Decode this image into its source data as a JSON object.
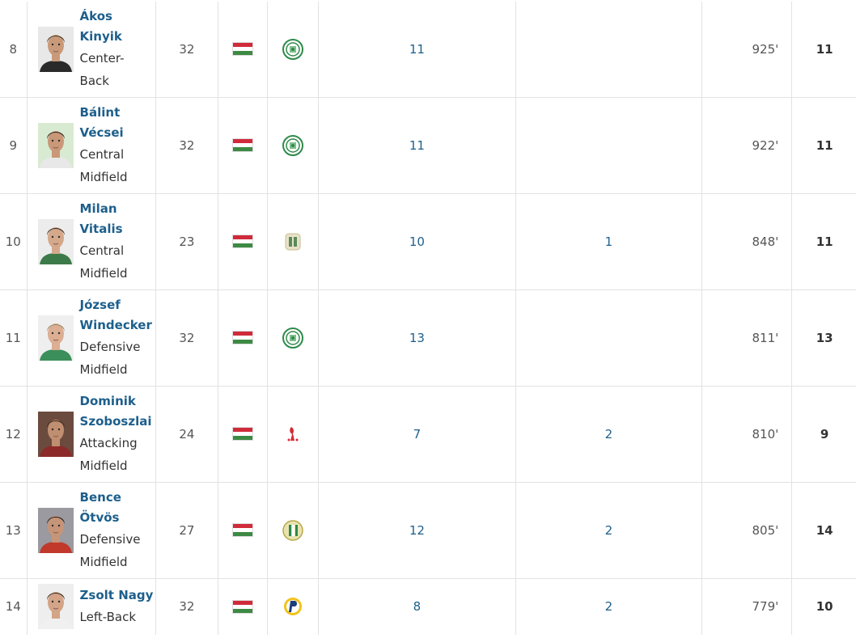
{
  "colors": {
    "link": "#1d5f8c",
    "border": "#e2e2e2",
    "flag_red": "#d02b3b",
    "flag_white": "#ffffff",
    "flag_green": "#3d8a44"
  },
  "rows": [
    {
      "rank": "8",
      "name_line1": "Ákos",
      "name_line2": "Kinyik",
      "position_line1": "Center-",
      "position_line2": "Back",
      "age": "32",
      "nationality": "Hungary",
      "club_icon": "ferencvaros-crest-icon",
      "apps": "11",
      "goals": "",
      "minutes": "925'",
      "total": "11",
      "skin": "#c99a7a",
      "hair": "#4a3a2c",
      "bg": "#e8e8e8",
      "shirt": "#2a2a2a"
    },
    {
      "rank": "9",
      "name_line1": "Bálint",
      "name_line2": "Vécsei",
      "position_line1": "Central",
      "position_line2": "Midfield",
      "age": "32",
      "nationality": "Hungary",
      "club_icon": "ferencvaros-crest-icon",
      "apps": "11",
      "goals": "",
      "minutes": "922'",
      "total": "11",
      "skin": "#c99878",
      "hair": "#2e2620",
      "bg": "#d9ead3",
      "shirt": "#e8e8e8"
    },
    {
      "rank": "10",
      "name_line1": "Milan",
      "name_line2": "Vitalis",
      "position_line1": "Central",
      "position_line2": "Midfield",
      "age": "23",
      "nationality": "Hungary",
      "club_icon": "paksi-crest-icon",
      "apps": "10",
      "goals": "1",
      "minutes": "848'",
      "total": "11",
      "skin": "#d4a88a",
      "hair": "#3a2d25",
      "bg": "#ececec",
      "shirt": "#3d7a4a"
    },
    {
      "rank": "11",
      "name_line1": "József",
      "name_line2": "Windecker",
      "position_line1": "Defensive",
      "position_line2": "Midfield",
      "age": "32",
      "nationality": "Hungary",
      "club_icon": "ferencvaros-crest-icon",
      "apps": "13",
      "goals": "",
      "minutes": "811'",
      "total": "13",
      "skin": "#dcae92",
      "hair": "#9a8a70",
      "bg": "#efefef",
      "shirt": "#3b8f5a"
    },
    {
      "rank": "12",
      "name_line1": "Dominik",
      "name_line2": "Szoboszlai",
      "position_line1": "Attacking",
      "position_line2": "Midfield",
      "age": "24",
      "nationality": "Hungary",
      "club_icon": "liverpool-crest-icon",
      "apps": "7",
      "goals": "2",
      "minutes": "810'",
      "total": "9",
      "skin": "#c08e70",
      "hair": "#3b2c22",
      "bg": "#6b4b3e",
      "shirt": "#8c2a2a"
    },
    {
      "rank": "13",
      "name_line1": "Bence",
      "name_line2": "Ötvös",
      "position_line1": "Defensive",
      "position_line2": "Midfield",
      "age": "27",
      "nationality": "Hungary",
      "club_icon": "ferencvaros-old-crest-icon",
      "apps": "12",
      "goals": "2",
      "minutes": "805'",
      "total": "14",
      "skin": "#c69478",
      "hair": "#2c221c",
      "bg": "#9a9aa0",
      "shirt": "#c0392b"
    },
    {
      "rank": "14",
      "name_line1": "Zsolt Nagy",
      "name_line2": "",
      "position_line1": "Left-Back",
      "position_line2": "",
      "age": "32",
      "nationality": "Hungary",
      "club_icon": "puskas-akademia-crest-icon",
      "apps": "8",
      "goals": "2",
      "minutes": "779'",
      "total": "10",
      "skin": "#d3a487",
      "hair": "#3a2e26",
      "bg": "#eeeeee",
      "shirt": "#f0f0f0"
    }
  ]
}
